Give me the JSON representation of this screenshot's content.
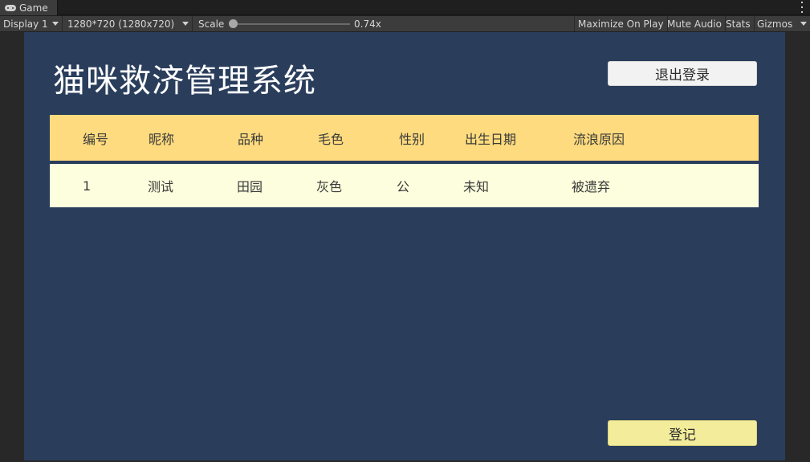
{
  "editor": {
    "tab_label": "Game",
    "display": "Display 1",
    "resolution": "1280*720 (1280x720)",
    "scale_label": "Scale",
    "scale_value": "0.74x",
    "scale_level": 0.0,
    "maximize": "Maximize On Play",
    "mute": "Mute Audio",
    "stats": "Stats",
    "gizmos": "Gizmos"
  },
  "app": {
    "title": "猫咪救济管理系统",
    "logout_label": "退出登录",
    "register_label": "登记",
    "colors": {
      "background": "#2a3e5c",
      "header_row": "#fddb7e",
      "data_row": "#fdfedd",
      "register_button": "#f3ec9a"
    }
  },
  "table": {
    "columns": [
      "编号",
      "昵称",
      "品种",
      "毛色",
      "性别",
      "出生日期",
      "流浪原因"
    ],
    "rows": [
      [
        "1",
        "测试",
        "田园",
        "灰色",
        "公",
        "未知",
        "被遗弃"
      ]
    ]
  }
}
